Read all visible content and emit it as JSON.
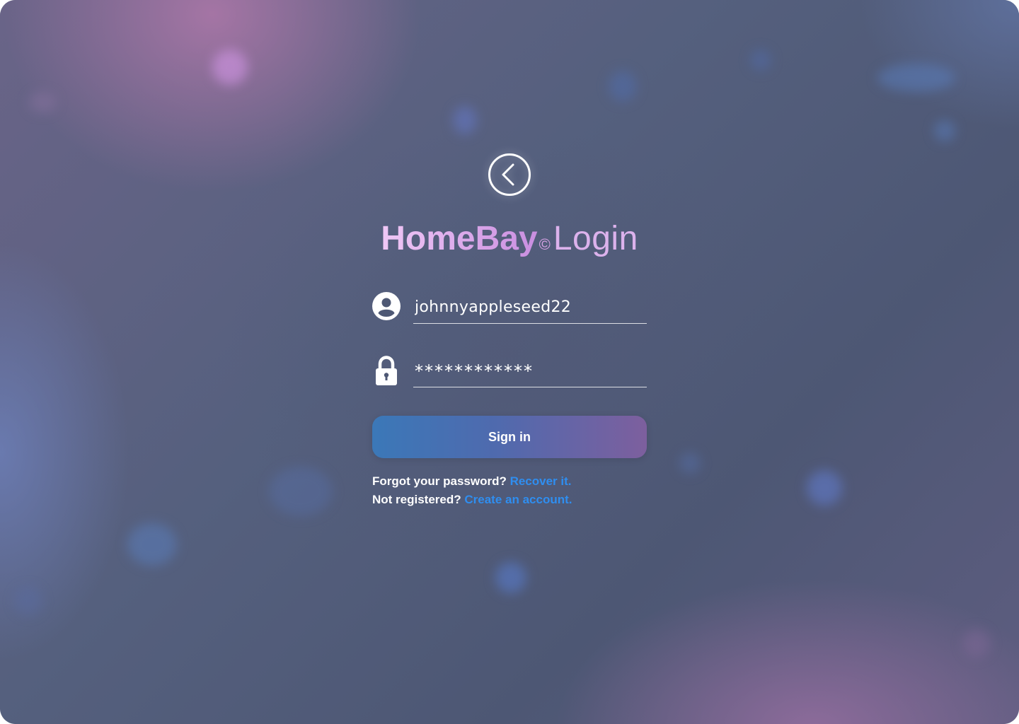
{
  "app": {
    "brand": "HomeBay",
    "brand_mark": "©",
    "title_word": "Login"
  },
  "navigation": {
    "back_icon": "chevron-left-circle-icon"
  },
  "form": {
    "username": {
      "icon": "user-circle-icon",
      "value": "johnnyappleseed22"
    },
    "password": {
      "icon": "lock-icon",
      "value": "************"
    },
    "signin_label": "Sign in"
  },
  "help": {
    "forgot_text": "Forgot your password?",
    "recover_link": "Recover it.",
    "register_text": "Not registered?",
    "create_link": "Create an account."
  },
  "colors": {
    "accent_link": "#2f8ef0",
    "brand_pink": "#d8a2e6",
    "button_gradient_start": "#3b78b8",
    "button_gradient_end": "#7d5f9e",
    "background": "#4e5874"
  }
}
